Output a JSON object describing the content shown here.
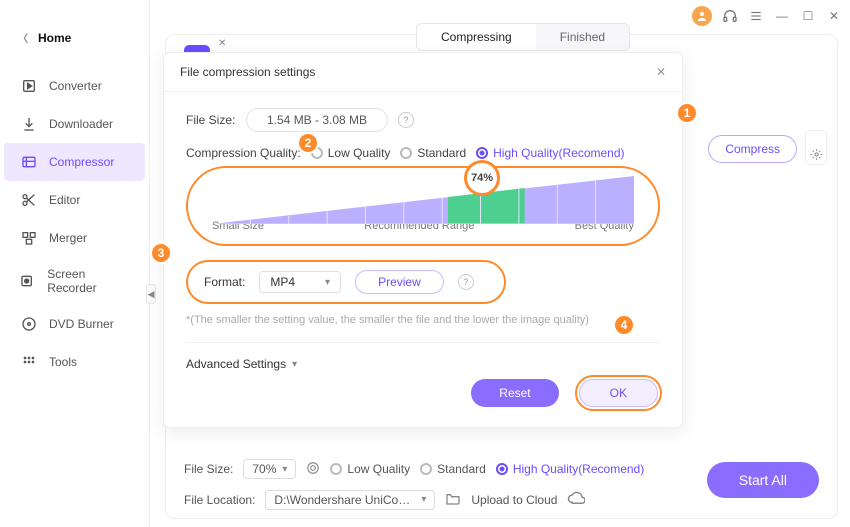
{
  "window": {
    "minimize": "—",
    "maximize": "☐",
    "close": "✕"
  },
  "sidebar": {
    "home": "Home",
    "items": [
      {
        "label": "Converter"
      },
      {
        "label": "Downloader"
      },
      {
        "label": "Compressor"
      },
      {
        "label": "Editor"
      },
      {
        "label": "Merger"
      },
      {
        "label": "Screen Recorder"
      },
      {
        "label": "DVD Burner"
      },
      {
        "label": "Tools"
      }
    ]
  },
  "main": {
    "tabs": {
      "compressing": "Compressing",
      "finished": "Finished"
    },
    "compress_btn": "Compress",
    "bottom": {
      "file_size_label": "File Size:",
      "file_size_value": "70%",
      "low": "Low Quality",
      "standard": "Standard",
      "high": "High Quality(Recomend)",
      "file_location_label": "File Location:",
      "file_location_value": "D:\\Wondershare UniConverter 1",
      "upload": "Upload to Cloud",
      "start_all": "Start All"
    }
  },
  "dialog": {
    "title": "File compression settings",
    "file_size_label": "File Size:",
    "file_size_value": "1.54 MB - 3.08 MB",
    "quality_label": "Compression Quality:",
    "low": "Low Quality",
    "standard": "Standard",
    "high": "High Quality(Recomend)",
    "slider": {
      "value_label": "74%",
      "small": "Small Size",
      "recommended": "Recommended Range",
      "best": "Best Quality"
    },
    "format_label": "Format:",
    "format_value": "MP4",
    "preview": "Preview",
    "note": "*(The smaller the setting value, the smaller the file and the lower the image quality)",
    "advanced": "Advanced Settings",
    "reset": "Reset",
    "ok": "OK"
  },
  "annotations": {
    "a1": "1",
    "a2": "2",
    "a3": "3",
    "a4": "4"
  },
  "chart_data": {
    "type": "area",
    "x": [
      0,
      100
    ],
    "series": [
      {
        "name": "Compression Quality",
        "values": [
          0,
          100
        ]
      }
    ],
    "recommended_range": [
      56,
      74
    ],
    "current_value": 74,
    "xlabel": "",
    "ylabel": "",
    "ticks": [
      "Small Size",
      "Recommended Range",
      "Best Quality"
    ]
  }
}
